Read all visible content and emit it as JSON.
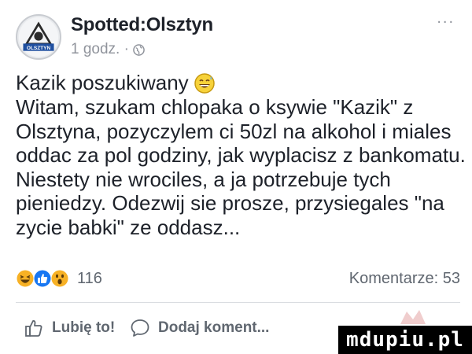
{
  "post": {
    "page_name": "Spotted:Olsztyn",
    "time": "1 godz. ·",
    "avatar_text": "OLSZTYN",
    "more": "...",
    "title": "Kazik poszukiwany",
    "body_lines": [
      "Witam, szukam chlopaka o ksywie \"Kazik\" z",
      "Olsztyna, pozyczylem ci 50zl na alkohol i miales",
      "oddac za pol godziny, jak wyplacisz z bankomatu.",
      "Niestety nie wrociles, a ja potrzebuje tych",
      "pieniedzy. Odezwij sie prosze, przysiegales \"na",
      "zycie babki\" ze oddasz..."
    ],
    "reaction_count": "116",
    "comments": "Komentarze: 53"
  },
  "actions": {
    "like": "Lubię to!",
    "comment": "Dodaj koment..."
  },
  "watermark": "mdupiu.pl",
  "colors": {
    "text": "#1d2129",
    "meta": "#90949c",
    "like_blue": "#1877f2",
    "haha_yellow": "#f7b125"
  }
}
